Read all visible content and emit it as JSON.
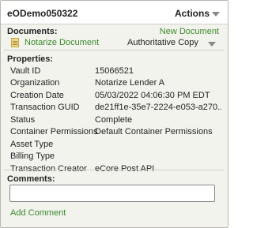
{
  "header": {
    "title": "eODemo050322",
    "actions_label": "Actions"
  },
  "documents": {
    "label": "Documents:",
    "new_document_label": "New Document",
    "item": {
      "name": "Notarize Document",
      "type": "Authoritative Copy"
    }
  },
  "properties": {
    "label": "Properties:",
    "rows": [
      {
        "key": "Vault ID",
        "value": "15066521"
      },
      {
        "key": "Organization",
        "value": "Notarize Lender A"
      },
      {
        "key": "Creation Date",
        "value": "05/03/2022 04:06:30 PM EDT"
      },
      {
        "key": "Transaction GUID",
        "value": "de21ff1e-35e7-2224-e053-a270..."
      },
      {
        "key": "Status",
        "value": "Complete"
      },
      {
        "key": "Container Permissions",
        "value": "Default Container Permissions"
      },
      {
        "key": "Asset Type",
        "value": ""
      },
      {
        "key": "Billing Type",
        "value": ""
      },
      {
        "key": "Transaction Creator",
        "value": "eCore Post API"
      }
    ]
  },
  "comments": {
    "label": "Comments:",
    "value": "",
    "add_label": "Add Comment"
  },
  "colors": {
    "link": "#3a8a2a",
    "panel_bg": "#f3f3ee"
  },
  "icons": {
    "actions": "triangle-down-icon",
    "document": "document-icon",
    "doc_menu": "triangle-down-icon"
  }
}
